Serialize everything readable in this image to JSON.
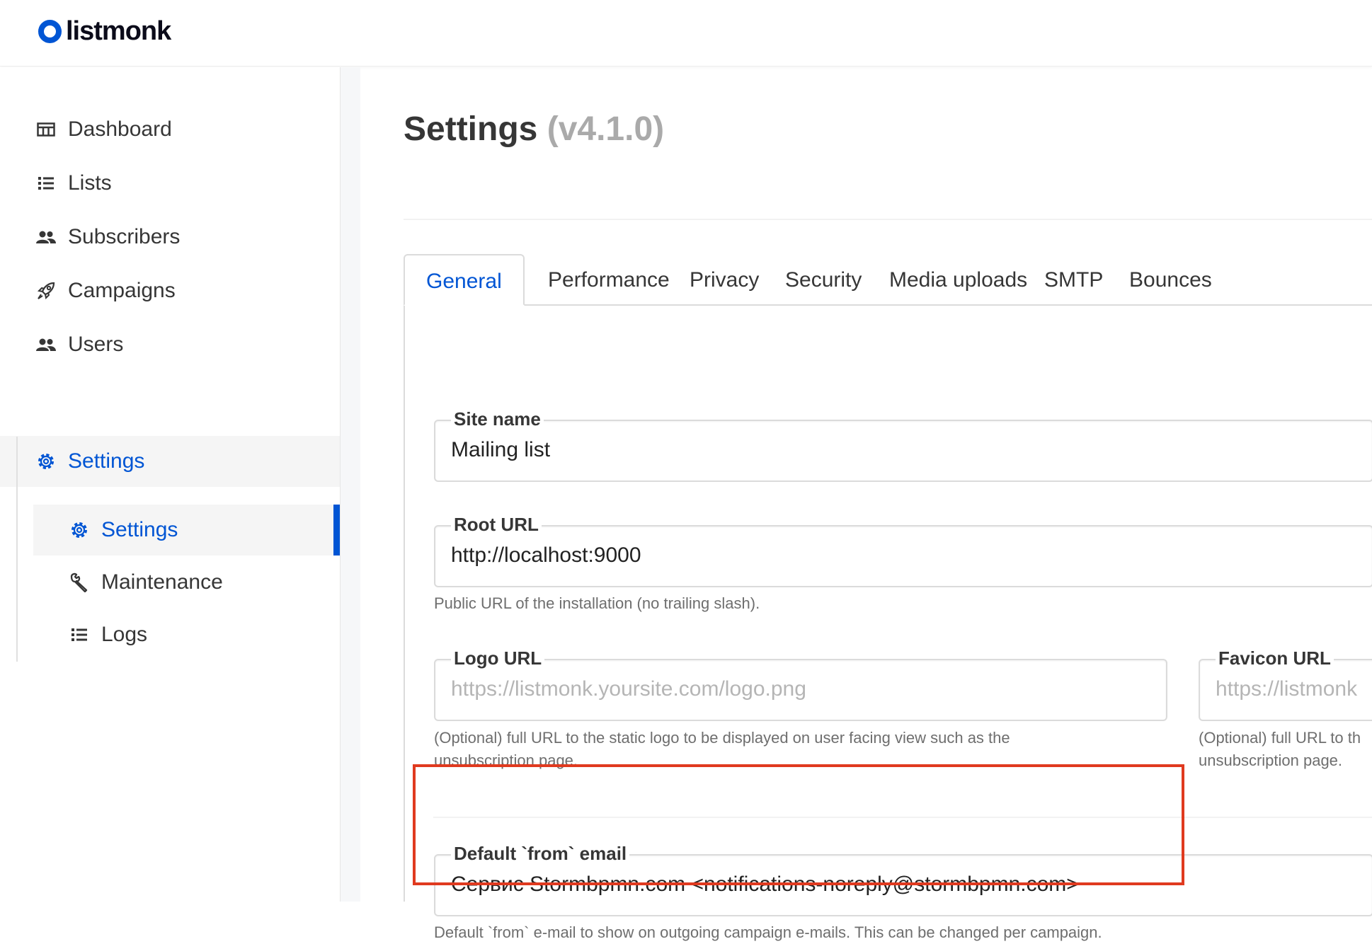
{
  "app": {
    "logo_text": "listmonk",
    "brand_color": "#0055d4"
  },
  "sidebar": {
    "items": [
      {
        "label": "Dashboard",
        "icon": "dashboard-icon"
      },
      {
        "label": "Lists",
        "icon": "list-icon"
      },
      {
        "label": "Subscribers",
        "icon": "users-icon"
      },
      {
        "label": "Campaigns",
        "icon": "rocket-icon"
      },
      {
        "label": "Users",
        "icon": "users-icon"
      },
      {
        "label": "Settings",
        "icon": "gear-icon",
        "active": true
      }
    ],
    "sub_items": [
      {
        "label": "Settings",
        "icon": "gear-icon",
        "active": true
      },
      {
        "label": "Maintenance",
        "icon": "wrench-icon"
      },
      {
        "label": "Logs",
        "icon": "list-icon"
      }
    ]
  },
  "page": {
    "title": "Settings",
    "version": "(v4.1.0)"
  },
  "tabs": [
    "General",
    "Performance",
    "Privacy",
    "Security",
    "Media uploads",
    "SMTP",
    "Bounces"
  ],
  "active_tab": "General",
  "form": {
    "site_name": {
      "label": "Site name",
      "value": "Mailing list"
    },
    "root_url": {
      "label": "Root URL",
      "value": "http://localhost:9000",
      "help": "Public URL of the installation (no trailing slash)."
    },
    "logo_url": {
      "label": "Logo URL",
      "placeholder": "https://listmonk.yoursite.com/logo.png",
      "help_line1": "(Optional) full URL to the static logo to be displayed on user facing view such as the",
      "help_line2": "unsubscription page."
    },
    "favicon_url": {
      "label": "Favicon URL",
      "placeholder": "https://listmonk",
      "help_line1": "(Optional) full URL to th",
      "help_line2": "unsubscription page."
    },
    "from_email": {
      "label": "Default `from` email",
      "value": "Сервис Stormbpmn.com <notifications-noreply@stormbpmn.com>",
      "help": "Default `from` e-mail to show on outgoing campaign e-mails. This can be changed per campaign."
    }
  },
  "highlight_color": "#e03a1f"
}
